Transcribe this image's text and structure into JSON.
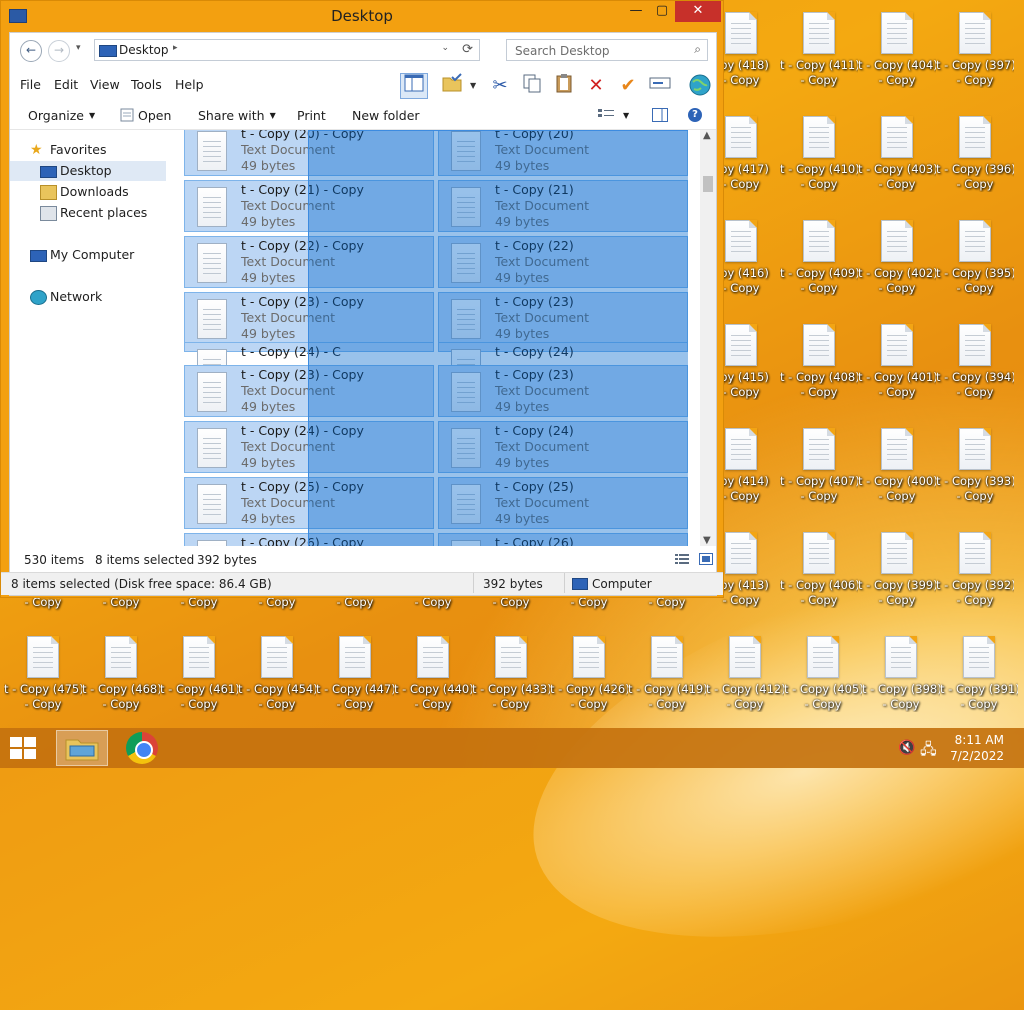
{
  "colors": {
    "window_frame": "#f3a010",
    "selection_fill": "#bcd6f4",
    "drag_rect": "#0066cc",
    "close_button": "#c7302a",
    "taskbar": "#c4720e"
  },
  "window": {
    "title": "Desktop",
    "controls": {
      "minimize": "—",
      "maximize": "▢",
      "close": "✕"
    },
    "address": {
      "location": "Desktop",
      "separator": "▸",
      "dropdown": "⌄",
      "refresh": "⟳"
    },
    "search": {
      "placeholder": "Search Desktop",
      "icon": "search-icon"
    },
    "nav_buttons": {
      "back": "←",
      "forward": "→",
      "history": "▾"
    },
    "menu": [
      "File",
      "Edit",
      "View",
      "Tools",
      "Help"
    ],
    "commands": {
      "organize": "Organize",
      "open": "Open",
      "share_with": "Share with",
      "print": "Print",
      "new_folder": "New folder",
      "help": "?"
    },
    "toolbar_icons": [
      "preview-pane-icon",
      "folder-check-icon",
      "cut-icon",
      "copy-icon",
      "paste-icon",
      "delete-icon",
      "checkmark-icon",
      "rename-icon",
      "globe-icon"
    ],
    "nav": {
      "favorites": "Favorites",
      "desktop": "Desktop",
      "downloads": "Downloads",
      "recent": "Recent places",
      "computer": "My Computer",
      "network": "Network"
    },
    "items": [
      {
        "name": "t - Copy (20) - Copy",
        "type": "Text Document",
        "size": "49 bytes"
      },
      {
        "name": "t - Copy (20)",
        "type": "Text Document",
        "size": "49 bytes"
      },
      {
        "name": "t - Copy (21) - Copy",
        "type": "Text Document",
        "size": "49 bytes"
      },
      {
        "name": "t - Copy (21)",
        "type": "Text Document",
        "size": "49 bytes"
      },
      {
        "name": "t - Copy (22) - Copy",
        "type": "Text Document",
        "size": "49 bytes"
      },
      {
        "name": "t - Copy (22)",
        "type": "Text Document",
        "size": "49 bytes"
      },
      {
        "name": "t - Copy (23) - Copy",
        "type": "Text Document",
        "size": "49 bytes"
      },
      {
        "name": "t - Copy (23)",
        "type": "Text Document",
        "size": "49 bytes"
      },
      {
        "name": "t - Copy (24) - C",
        "type": "",
        "size": ""
      },
      {
        "name": "t - Copy (24)",
        "type": "",
        "size": ""
      },
      {
        "name": "t - Copy (23) - Copy",
        "type": "Text Document",
        "size": "49 bytes"
      },
      {
        "name": "t - Copy (23)",
        "type": "Text Document",
        "size": "49 bytes"
      },
      {
        "name": "t - Copy (24) - Copy",
        "type": "Text Document",
        "size": "49 bytes"
      },
      {
        "name": "t - Copy (24)",
        "type": "Text Document",
        "size": "49 bytes"
      },
      {
        "name": "t - Copy (25) - Copy",
        "type": "Text Document",
        "size": "49 bytes"
      },
      {
        "name": "t - Copy (25)",
        "type": "Text Document",
        "size": "49 bytes"
      },
      {
        "name": "t - Copy (26) - Copy",
        "type": "",
        "size": ""
      },
      {
        "name": "t - Copy (26)",
        "type": "",
        "size": ""
      }
    ],
    "status_bar": {
      "count": "530 items",
      "selected": "8 items selected",
      "selected_size": "392 bytes"
    },
    "details_bar": {
      "left": "8 items selected (Disk free space: 86.4 GB)",
      "size": "392 bytes",
      "location": "Computer"
    }
  },
  "desktop_icons": {
    "right_columns": [
      {
        "line1": "opy (418)",
        "line2": "- Copy"
      },
      {
        "line1": "t - Copy (411)",
        "line2": "- Copy"
      },
      {
        "line1": "t - Copy (404)",
        "line2": "- Copy"
      },
      {
        "line1": "t - Copy (397)",
        "line2": "- Copy"
      },
      {
        "line1": "opy (417)",
        "line2": "- Copy"
      },
      {
        "line1": "t - Copy (410)",
        "line2": "- Copy"
      },
      {
        "line1": "t - Copy (403)",
        "line2": "- Copy"
      },
      {
        "line1": "t - Copy (396)",
        "line2": "- Copy"
      },
      {
        "line1": "opy (416)",
        "line2": "- Copy"
      },
      {
        "line1": "t - Copy (409)",
        "line2": "- Copy"
      },
      {
        "line1": "t - Copy (402)",
        "line2": "- Copy"
      },
      {
        "line1": "t - Copy (395)",
        "line2": "- Copy"
      },
      {
        "line1": "opy (415)",
        "line2": "- Copy"
      },
      {
        "line1": "t - Copy (408)",
        "line2": "- Copy"
      },
      {
        "line1": "t - Copy (401)",
        "line2": "- Copy"
      },
      {
        "line1": "t - Copy (394)",
        "line2": "- Copy"
      },
      {
        "line1": "opy (414)",
        "line2": "- Copy"
      },
      {
        "line1": "t - Copy (407)",
        "line2": "- Copy"
      },
      {
        "line1": "t - Copy (400)",
        "line2": "- Copy"
      },
      {
        "line1": "t - Copy (393)",
        "line2": "- Copy"
      },
      {
        "line1": "opy (413)",
        "line2": "- Copy"
      },
      {
        "line1": "t - Copy (406)",
        "line2": "- Copy"
      },
      {
        "line1": "t - Copy (399)",
        "line2": "- Copy"
      },
      {
        "line1": "t - Copy (392)",
        "line2": "- Copy"
      }
    ],
    "bottom_row_top": [
      "- Copy",
      "- Copy",
      "- Copy",
      "- Copy",
      "- Copy",
      "- Copy",
      "- Copy",
      "- Copy",
      "- Copy",
      "- Copy",
      "- Copy",
      "- Copy",
      "- Copy"
    ],
    "bottom_row": [
      {
        "line1": "t - Copy (475)",
        "line2": "- Copy"
      },
      {
        "line1": "t - Copy (468)",
        "line2": "- Copy"
      },
      {
        "line1": "t - Copy (461)",
        "line2": "- Copy"
      },
      {
        "line1": "t - Copy (454)",
        "line2": "- Copy"
      },
      {
        "line1": "t - Copy (447)",
        "line2": "- Copy"
      },
      {
        "line1": "t - Copy (440)",
        "line2": "- Copy"
      },
      {
        "line1": "t - Copy (433)",
        "line2": "- Copy"
      },
      {
        "line1": "t - Copy (426)",
        "line2": "- Copy"
      },
      {
        "line1": "t - Copy (419)",
        "line2": "- Copy"
      },
      {
        "line1": "t - Copy (412)",
        "line2": "- Copy"
      },
      {
        "line1": "t - Copy (405)",
        "line2": "- Copy"
      },
      {
        "line1": "t - Copy (398)",
        "line2": "- Copy"
      },
      {
        "line1": "t - Copy (391)",
        "line2": "- Copy"
      }
    ]
  },
  "taskbar": {
    "clock_time": "8:11 AM",
    "clock_date": "7/2/2022",
    "tray": {
      "volume": "🔇",
      "network": "🖧"
    }
  }
}
